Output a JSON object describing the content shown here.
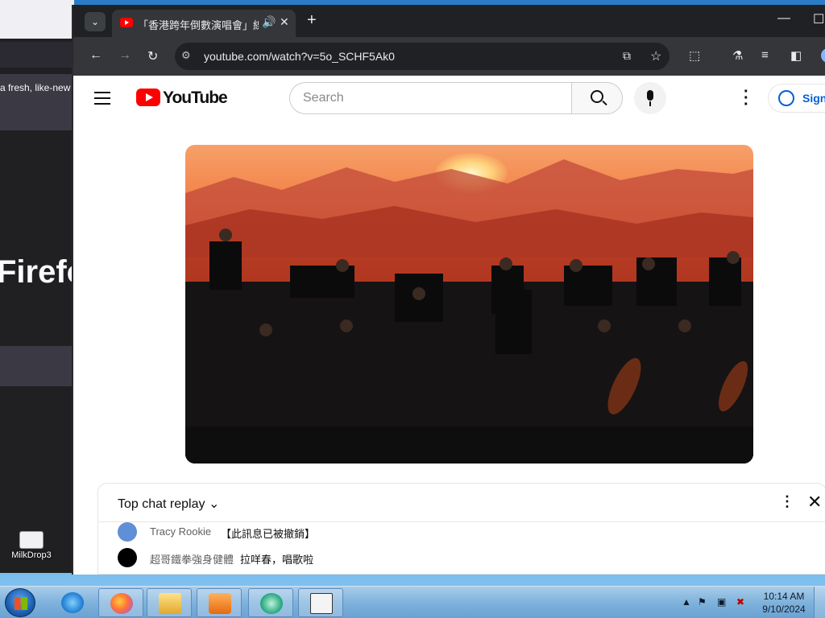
{
  "desktop": {
    "firefox_note": "a fresh, like-new",
    "firefox_word": "Firefo",
    "icon_label": "MilkDrop3"
  },
  "browser": {
    "tab_title": "「香港跨年倒數演唱會」線上",
    "tab_sound_icon": "speaker-icon",
    "tab_close": "✕",
    "new_tab": "+",
    "minimize": "—",
    "maximize": "☐",
    "url": "youtube.com/watch?v=5o_SCHF5Ak0",
    "back": "←",
    "forward": "→",
    "reload": "↻"
  },
  "youtube": {
    "logo_text": "YouTube",
    "search_placeholder": "Search",
    "sign_in": "Sign",
    "chat": {
      "header": "Top chat replay ⌄",
      "messages": [
        {
          "author": "Tracy Rookie",
          "text": "【此訊息已被撤銷】",
          "avatar_color": "#5f8fd6"
        },
        {
          "author": "超哥鐵拳強身健體",
          "text": "拉咩春，唱歌啦",
          "avatar_color": "#000000"
        },
        {
          "author": "",
          "text": "",
          "avatar_color": "#9a9a9a"
        }
      ]
    }
  },
  "taskbar": {
    "time": "10:14 AM",
    "date": "9/10/2024",
    "tray_up": "▲"
  },
  "colors": {
    "youtube_red": "#ff0000",
    "chrome_dark": "#35363a",
    "link_blue": "#065fd4"
  }
}
